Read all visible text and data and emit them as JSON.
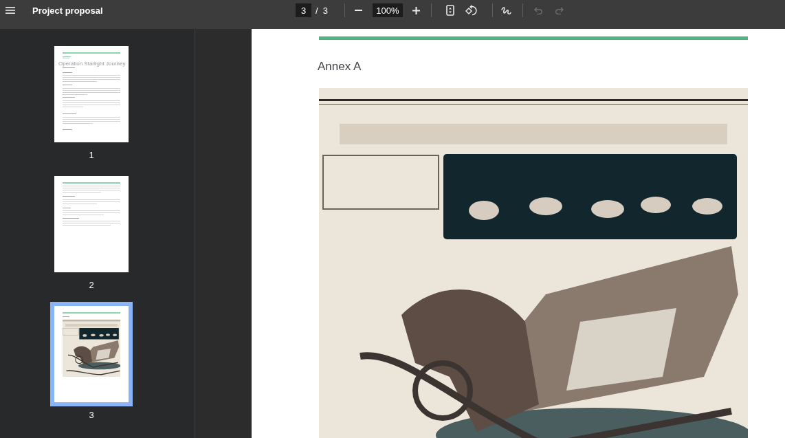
{
  "toolbar": {
    "title": "Project proposal",
    "page_input": "3",
    "page_separator": "/",
    "page_count": "3",
    "zoom": "100%",
    "undo": {
      "disabled": true
    },
    "redo": {
      "disabled": true
    }
  },
  "sidebar": {
    "thumbnails": [
      {
        "kind": "text",
        "title": "Operation Starlight Journey",
        "label": "1",
        "selected": false
      },
      {
        "kind": "text",
        "label": "2",
        "selected": false
      },
      {
        "kind": "figure",
        "label": "3",
        "selected": true
      }
    ]
  },
  "page": {
    "heading": "Annex A"
  }
}
